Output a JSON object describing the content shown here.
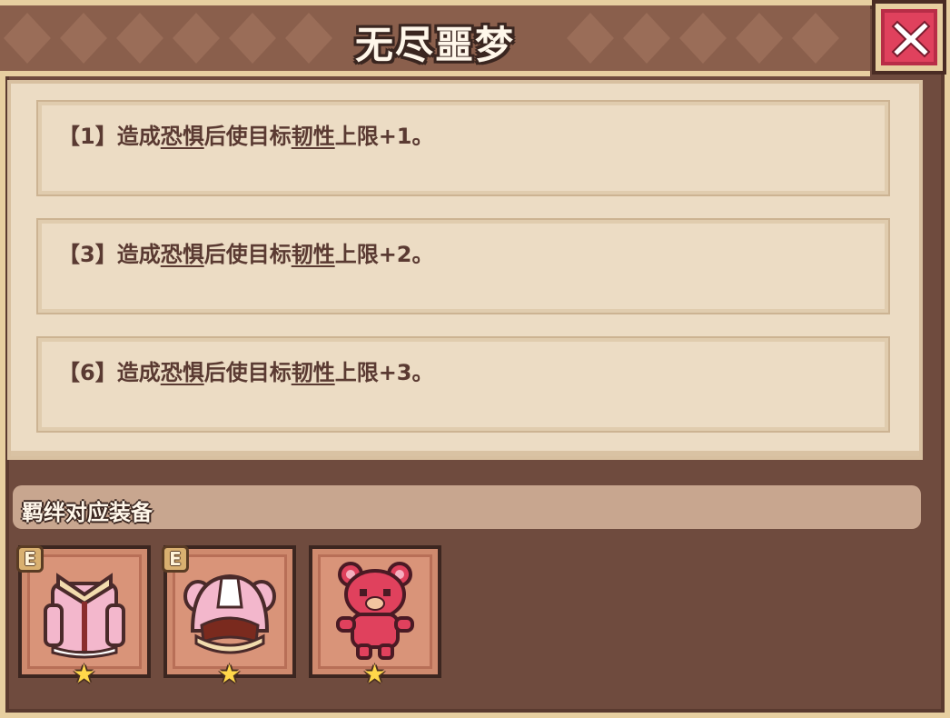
{
  "window": {
    "title": "无尽噩梦"
  },
  "effects": [
    {
      "prefix": "【1】造成",
      "kw1": "恐惧",
      "mid": "后使目标",
      "kw2": "韧性",
      "suffix": "上限+1。"
    },
    {
      "prefix": "【3】造成",
      "kw1": "恐惧",
      "mid": "后使目标",
      "kw2": "韧性",
      "suffix": "上限+2。"
    },
    {
      "prefix": "【6】造成",
      "kw1": "恐惧",
      "mid": "后使目标",
      "kw2": "韧性",
      "suffix": "上限+3。"
    }
  ],
  "equipment_section": {
    "label": "羁绊对应装备",
    "items": [
      {
        "icon": "pink-cloak-icon",
        "badge": "E",
        "star": "★"
      },
      {
        "icon": "pink-hat-icon",
        "badge": "E",
        "star": "★"
      },
      {
        "icon": "red-bear-doll-icon",
        "badge": "",
        "star": "★"
      }
    ]
  },
  "colors": {
    "frame": "#6f4b3e",
    "panel": "#ecdcc4",
    "text": "#5a3a32",
    "close_red": "#e0415d",
    "star": "#ffd84a"
  }
}
